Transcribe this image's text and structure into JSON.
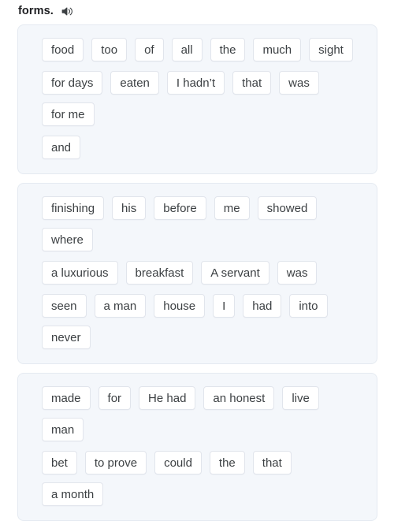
{
  "header": {
    "title": "forms.",
    "audio_icon": "speaker-icon"
  },
  "cards": [
    {
      "rows": [
        [
          "food",
          "too",
          "of",
          "all",
          "the",
          "much",
          "sight"
        ],
        [
          "for days",
          "eaten",
          "I hadn’t",
          "that",
          "was",
          "for me"
        ],
        [
          "and"
        ]
      ]
    },
    {
      "rows": [
        [
          "finishing",
          "his",
          "before",
          "me",
          "showed",
          "where"
        ],
        [
          "a luxurious",
          "breakfast",
          "A servant",
          "was"
        ],
        [
          "seen",
          "a man",
          "house",
          "I",
          "had",
          "into",
          "never"
        ]
      ]
    },
    {
      "rows": [
        [
          "made",
          "for",
          "He had",
          "an honest",
          "live",
          "man"
        ],
        [
          "bet",
          "to prove",
          "could",
          "the",
          "that",
          "a month"
        ]
      ]
    }
  ],
  "colors": {
    "page_background": "#ffffff",
    "card_background": "#f4f7fb",
    "card_border": "#e5eaf1",
    "chip_background": "#ffffff",
    "chip_border": "#e1e5ec",
    "chip_text": "#3c4043",
    "title_text": "#202124"
  }
}
